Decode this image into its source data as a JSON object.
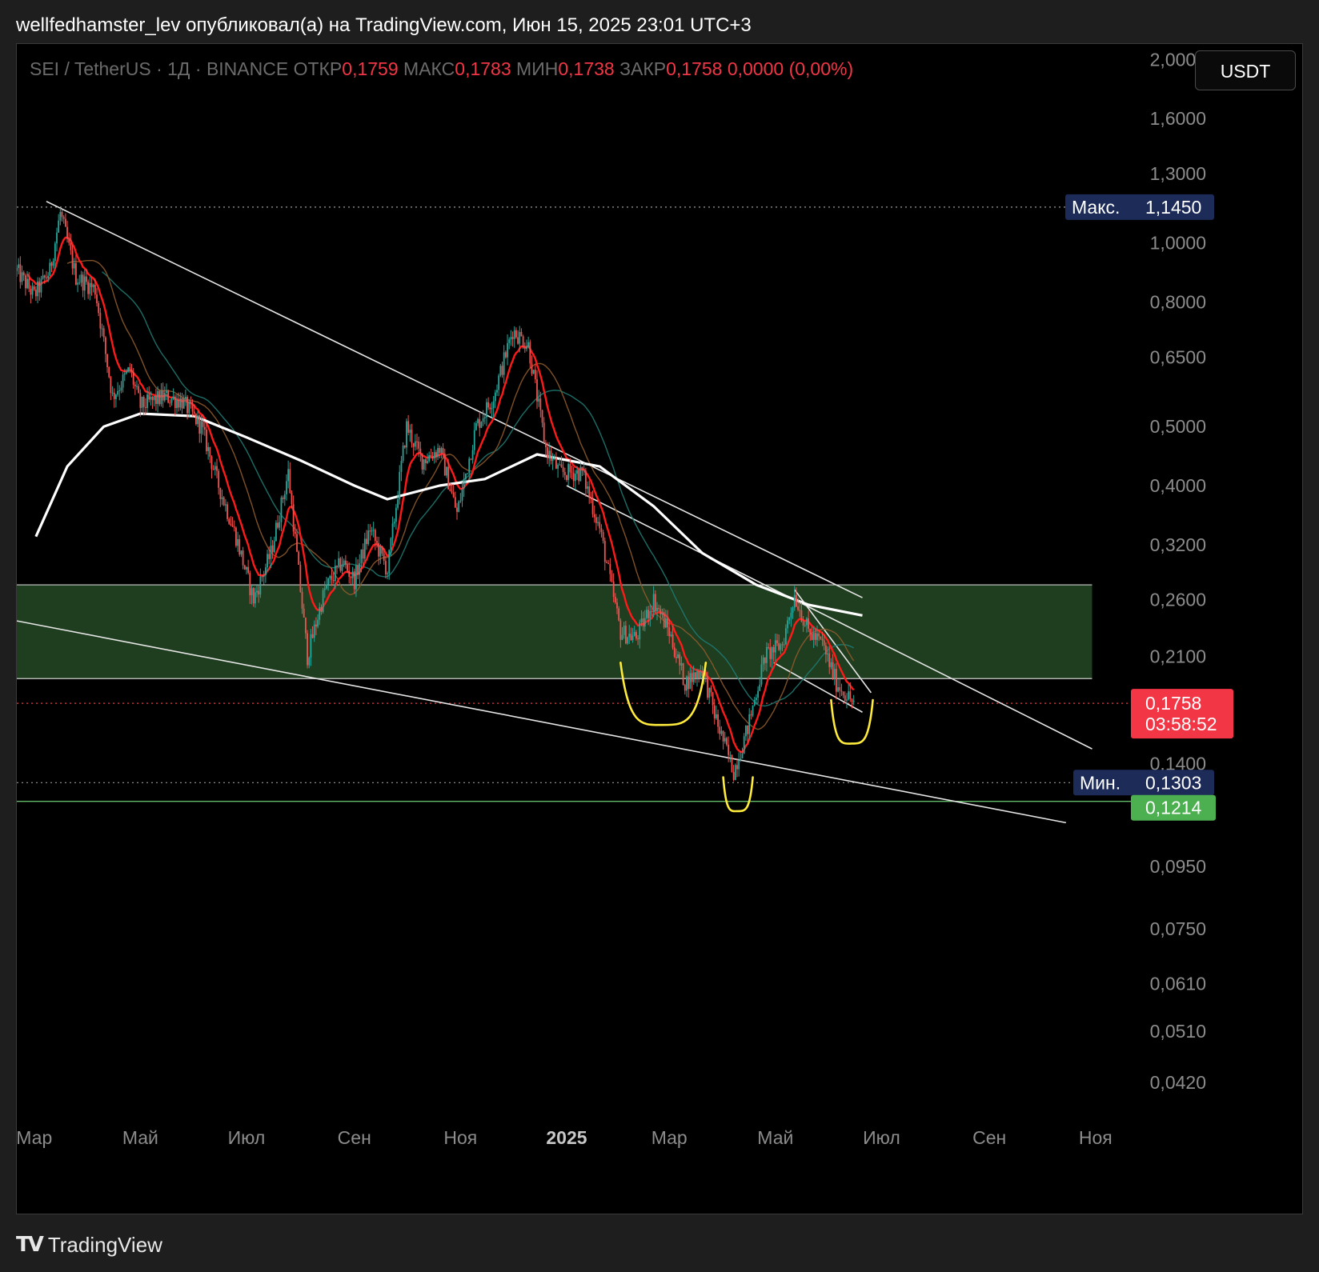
{
  "header": {
    "publish_text": "wellfedhamster_lev опубликовал(а) на TradingView.com, Июн 15, 2025 23:01 UTC+3"
  },
  "legend": {
    "symbol": "SEI / TetherUS · 1Д · BINANCE",
    "open_label": "ОТКР",
    "open": "0,1759",
    "high_label": "МАКС",
    "high": "0,1783",
    "low_label": "МИН",
    "low": "0,1738",
    "close_label": "ЗАКР",
    "close": "0,1758",
    "change": "0,0000 (0,00%)"
  },
  "currency_button": "USDT",
  "footer": {
    "brand": "TradingView",
    "logo_glyph": "TV"
  },
  "colors": {
    "background": "#000000",
    "up": "#26a69a",
    "down": "#ef5350",
    "ema_fast": "#ff1a1a",
    "sma_slow": "#ffffff",
    "zone": "#1f3d1f",
    "annotation_yellow": "#ffeb3b",
    "label_max": "#1c2b57",
    "label_price": "#f23645",
    "label_support": "#4caf50"
  },
  "chart_data": {
    "type": "candlestick",
    "scale": "log",
    "ylim": [
      0.037,
      2.12
    ],
    "x_range": [
      "2024-02-20",
      "2025-11-25"
    ],
    "x_ticks": [
      {
        "date": "2024-03-01",
        "label": "Мар",
        "bold": false
      },
      {
        "date": "2024-05-01",
        "label": "Май",
        "bold": false
      },
      {
        "date": "2024-07-01",
        "label": "Июл",
        "bold": false
      },
      {
        "date": "2024-09-01",
        "label": "Сен",
        "bold": false
      },
      {
        "date": "2024-11-01",
        "label": "Ноя",
        "bold": false
      },
      {
        "date": "2025-01-01",
        "label": "2025",
        "bold": true
      },
      {
        "date": "2025-03-01",
        "label": "Мар",
        "bold": false
      },
      {
        "date": "2025-05-01",
        "label": "Май",
        "bold": false
      },
      {
        "date": "2025-07-01",
        "label": "Июл",
        "bold": false
      },
      {
        "date": "2025-09-01",
        "label": "Сен",
        "bold": false
      },
      {
        "date": "2025-11-01",
        "label": "Ноя",
        "bold": false
      }
    ],
    "y_ticks": [
      {
        "value": 2.0,
        "label": "2,0000"
      },
      {
        "value": 1.6,
        "label": "1,6000"
      },
      {
        "value": 1.3,
        "label": "1,3000"
      },
      {
        "value": 1.0,
        "label": "1,0000"
      },
      {
        "value": 0.8,
        "label": "0,8000"
      },
      {
        "value": 0.65,
        "label": "0,6500"
      },
      {
        "value": 0.5,
        "label": "0,5000"
      },
      {
        "value": 0.4,
        "label": "0,4000"
      },
      {
        "value": 0.32,
        "label": "0,3200"
      },
      {
        "value": 0.26,
        "label": "0,2600"
      },
      {
        "value": 0.21,
        "label": "0,2100"
      },
      {
        "value": 0.14,
        "label": "0,1400"
      },
      {
        "value": 0.095,
        "label": "0,0950"
      },
      {
        "value": 0.075,
        "label": "0,0750"
      },
      {
        "value": 0.061,
        "label": "0,0610"
      },
      {
        "value": 0.051,
        "label": "0,0510"
      },
      {
        "value": 0.042,
        "label": "0,0420"
      }
    ],
    "price_path": [
      [
        "2024-02-20",
        0.9
      ],
      [
        "2024-03-01",
        0.82
      ],
      [
        "2024-03-10",
        0.9
      ],
      [
        "2024-03-16",
        1.12
      ],
      [
        "2024-03-25",
        0.88
      ],
      [
        "2024-04-05",
        0.84
      ],
      [
        "2024-04-15",
        0.56
      ],
      [
        "2024-04-25",
        0.62
      ],
      [
        "2024-05-01",
        0.54
      ],
      [
        "2024-05-15",
        0.56
      ],
      [
        "2024-05-25",
        0.55
      ],
      [
        "2024-06-05",
        0.5
      ],
      [
        "2024-06-15",
        0.4
      ],
      [
        "2024-06-25",
        0.33
      ],
      [
        "2024-07-05",
        0.26
      ],
      [
        "2024-07-15",
        0.31
      ],
      [
        "2024-07-25",
        0.42
      ],
      [
        "2024-08-05",
        0.21
      ],
      [
        "2024-08-15",
        0.27
      ],
      [
        "2024-08-25",
        0.3
      ],
      [
        "2024-09-01",
        0.28
      ],
      [
        "2024-09-10",
        0.34
      ],
      [
        "2024-09-20",
        0.29
      ],
      [
        "2024-10-01",
        0.5
      ],
      [
        "2024-10-10",
        0.44
      ],
      [
        "2024-10-20",
        0.46
      ],
      [
        "2024-10-30",
        0.36
      ],
      [
        "2024-11-10",
        0.5
      ],
      [
        "2024-11-20",
        0.56
      ],
      [
        "2024-12-01",
        0.72
      ],
      [
        "2024-12-10",
        0.68
      ],
      [
        "2024-12-20",
        0.46
      ],
      [
        "2024-12-28",
        0.42
      ],
      [
        "2025-01-10",
        0.42
      ],
      [
        "2025-01-20",
        0.34
      ],
      [
        "2025-02-01",
        0.23
      ],
      [
        "2025-02-10",
        0.225
      ],
      [
        "2025-02-20",
        0.26
      ],
      [
        "2025-03-01",
        0.23
      ],
      [
        "2025-03-10",
        0.19
      ],
      [
        "2025-03-20",
        0.2
      ],
      [
        "2025-03-28",
        0.165
      ],
      [
        "2025-04-07",
        0.136
      ],
      [
        "2025-04-15",
        0.16
      ],
      [
        "2025-04-25",
        0.21
      ],
      [
        "2025-05-05",
        0.22
      ],
      [
        "2025-05-12",
        0.265
      ],
      [
        "2025-05-20",
        0.23
      ],
      [
        "2025-05-28",
        0.22
      ],
      [
        "2025-06-05",
        0.19
      ],
      [
        "2025-06-12",
        0.18
      ],
      [
        "2025-06-15",
        0.1758
      ]
    ],
    "sma_slow_path": [
      [
        "2024-03-02",
        0.33
      ],
      [
        "2024-03-20",
        0.43
      ],
      [
        "2024-04-10",
        0.5
      ],
      [
        "2024-05-01",
        0.525
      ],
      [
        "2024-06-01",
        0.52
      ],
      [
        "2024-07-01",
        0.48
      ],
      [
        "2024-08-01",
        0.44
      ],
      [
        "2024-09-01",
        0.4
      ],
      [
        "2024-09-20",
        0.38
      ],
      [
        "2024-10-20",
        0.4
      ],
      [
        "2024-11-15",
        0.41
      ],
      [
        "2024-12-15",
        0.45
      ],
      [
        "2025-01-20",
        0.43
      ],
      [
        "2025-02-20",
        0.37
      ],
      [
        "2025-03-20",
        0.31
      ],
      [
        "2025-04-20",
        0.275
      ],
      [
        "2025-05-20",
        0.255
      ],
      [
        "2025-06-20",
        0.245
      ]
    ],
    "zone": {
      "low": 0.193,
      "high": 0.275,
      "x_end": "2025-10-30"
    },
    "max_value": "1,1450",
    "max_label": "Макс.",
    "min_value": "0,1303",
    "min_label": "Мин.",
    "last_price": "0,1758",
    "countdown": "03:58:52",
    "support_value": "0,1214",
    "trendlines": [
      {
        "from": [
          "2024-03-08",
          1.17
        ],
        "to": [
          "2025-06-20",
          0.262
        ]
      },
      {
        "from": [
          "2025-01-01",
          0.4
        ],
        "to": [
          "2025-10-30",
          0.148
        ]
      },
      {
        "from": [
          "2024-02-20",
          0.24
        ],
        "to": [
          "2025-10-15",
          0.112
        ]
      },
      {
        "from": [
          "2025-05-12",
          0.27
        ],
        "to": [
          "2025-06-25",
          0.183
        ]
      },
      {
        "from": [
          "2025-04-30",
          0.205
        ],
        "to": [
          "2025-06-20",
          0.17
        ]
      }
    ],
    "annotations": [
      {
        "type": "cup",
        "from": "2025-02-01",
        "to": "2025-03-22",
        "top": 0.205,
        "bottom": 0.162
      },
      {
        "type": "cup",
        "from": "2025-04-01",
        "to": "2025-04-18",
        "top": 0.133,
        "bottom": 0.117
      },
      {
        "type": "cup",
        "from": "2025-06-02",
        "to": "2025-06-26",
        "top": 0.178,
        "bottom": 0.151
      }
    ]
  }
}
